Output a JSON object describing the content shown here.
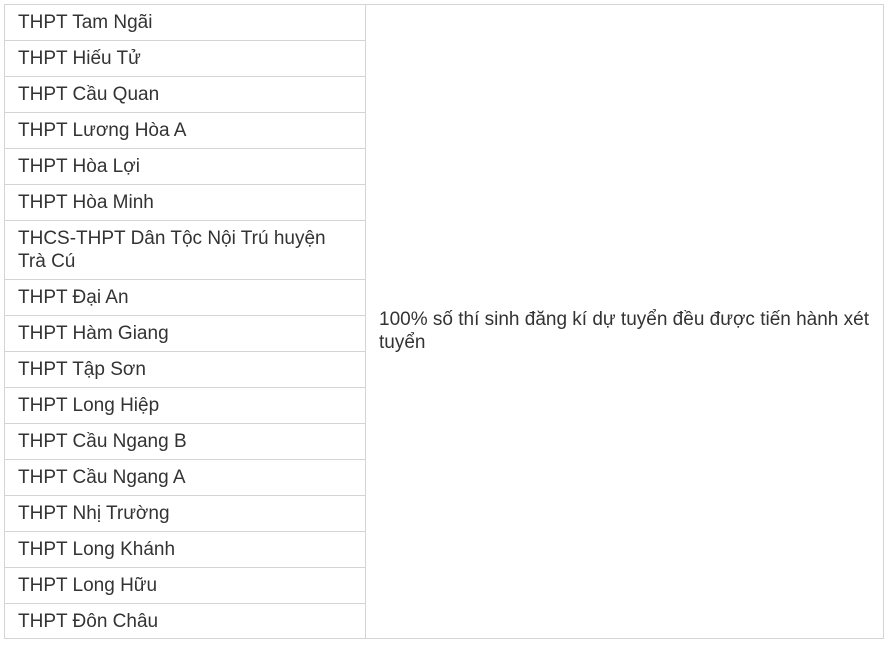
{
  "schools": [
    "THPT Tam Ngãi",
    "THPT Hiếu Tử",
    "THPT Cầu Quan",
    "THPT Lương Hòa A",
    "THPT Hòa Lợi",
    "THPT Hòa Minh",
    "THCS-THPT Dân Tộc Nội Trú huyện Trà Cú",
    "THPT Đại An",
    "THPT Hàm Giang",
    "THPT Tập Sơn",
    "THPT Long Hiệp",
    "THPT Cầu Ngang B",
    "THPT Cầu Ngang A",
    "THPT Nhị Trường",
    "THPT Long Khánh",
    "THPT Long Hữu",
    "THPT Đôn Châu"
  ],
  "note": "100% số thí sinh đăng kí dự tuyển đều được tiến hành xét tuyển"
}
